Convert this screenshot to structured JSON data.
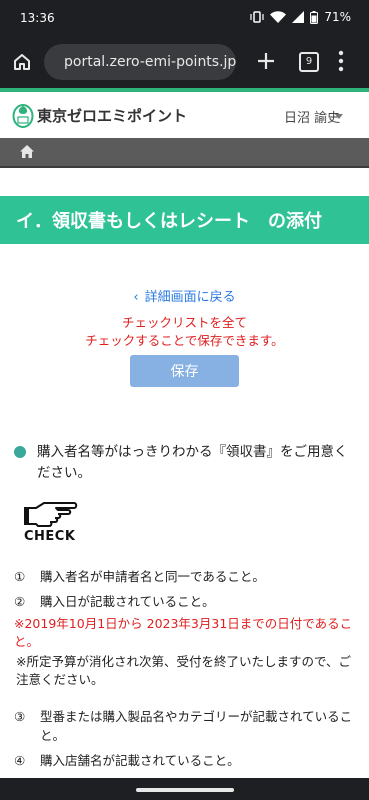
{
  "status": {
    "time": "13:36",
    "battery": "71%"
  },
  "browser": {
    "url": "portal.zero-emi-points.jp",
    "tab_count": "9"
  },
  "site": {
    "brand": "東京ゼロエミポイント",
    "user": "日沼 諭史"
  },
  "page": {
    "title": "イ．領収書もしくはレシート　の添付",
    "back_link": "詳細画面に戻る",
    "warning_line1": "チェックリストを全て",
    "warning_line2": "チェックすることで保存できます。",
    "save_label": "保存",
    "intro": "購入者名等がはっきりわかる『領収書』をご用意ください。",
    "check_label": "CHECK",
    "items": [
      {
        "num": "①",
        "text": "購入者名が申請者名と同一であること。"
      },
      {
        "num": "②",
        "text": "購入日が記載されていること。"
      }
    ],
    "note_red": "※2019年10月1日から 2023年3月31日までの日付であること。",
    "note_black": "※所定予算が消化され次第、受付を終了いたしますので、ご注意ください。",
    "items2": [
      {
        "num": "③",
        "text": "型番または購入製品名やカテゴリーが記載されていること。"
      },
      {
        "num": "④",
        "text": "購入店舗名が記載されていること。"
      }
    ]
  },
  "colors": {
    "accent_green": "#2ec295",
    "warning_red": "#e02020",
    "link_blue": "#2a7ae2",
    "save_button": "#88b1e3"
  }
}
